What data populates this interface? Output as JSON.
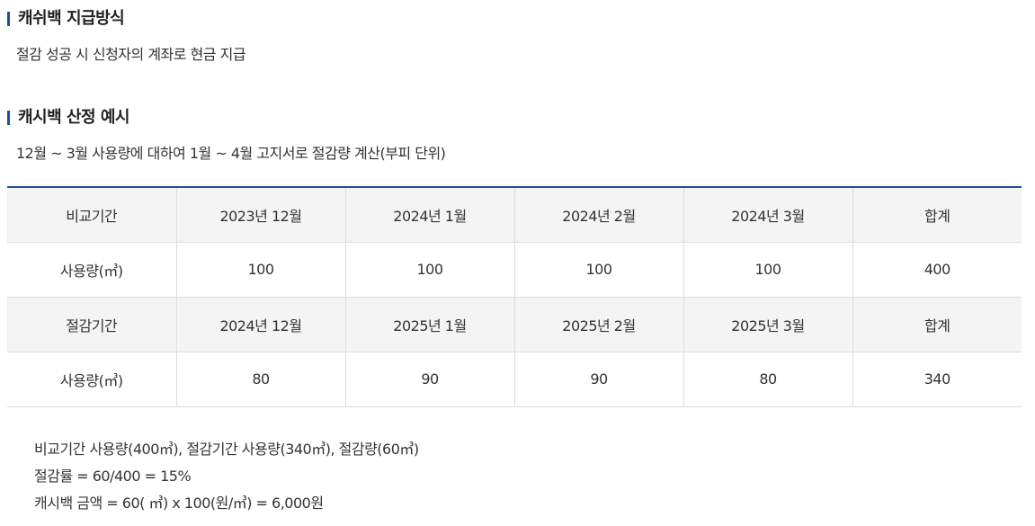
{
  "section1": {
    "title": "캐쉬백 지급방식",
    "desc": "절감 성공 시 신청자의 계좌로 현금 지급"
  },
  "section2": {
    "title": "캐시백 산정 예시",
    "desc": "12월 ~ 3월 사용량에 대하여 1월 ~ 4월 고지서로 절감량 계산(부피 단위)"
  },
  "table": {
    "rows": [
      [
        "비교기간",
        "2023년 12월",
        "2024년 1월",
        "2024년 2월",
        "2024년 3월",
        "합계"
      ],
      [
        "사용량(㎥)",
        "100",
        "100",
        "100",
        "100",
        "400"
      ],
      [
        "절감기간",
        "2024년 12월",
        "2025년 1월",
        "2025년 2월",
        "2025년 3월",
        "합계"
      ],
      [
        "사용량(㎥)",
        "80",
        "90",
        "90",
        "80",
        "340"
      ]
    ]
  },
  "notes": {
    "line1": "비교기간 사용량(400㎥), 절감기간 사용량(340㎥), 절감량(60㎥)",
    "line2": "절감률 = 60/400 = 15%",
    "line3": "캐시백 금액 = 60( ㎥) x 100(원/㎥) = 6,000원"
  }
}
